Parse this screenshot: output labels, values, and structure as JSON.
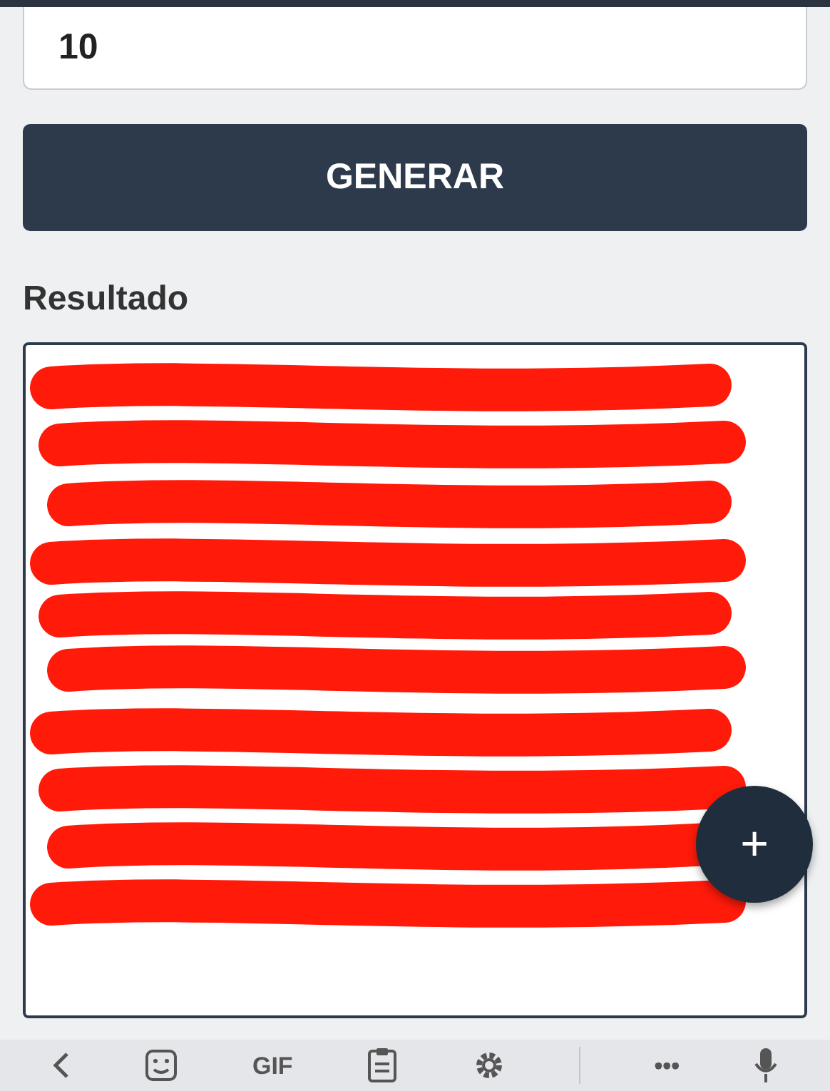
{
  "count_field": {
    "value": "10"
  },
  "generate_button": {
    "label": "GENERAR"
  },
  "result": {
    "label": "Resultado"
  },
  "fab": {
    "label": "+"
  },
  "keyboard_toolbar": [
    {
      "kind": "back"
    },
    {
      "kind": "sticker"
    },
    {
      "kind": "text",
      "label": "GIF"
    },
    {
      "kind": "clipboard"
    },
    {
      "kind": "settings"
    },
    {
      "kind": "divider"
    },
    {
      "kind": "text",
      "label": "•••"
    },
    {
      "kind": "mic"
    }
  ]
}
